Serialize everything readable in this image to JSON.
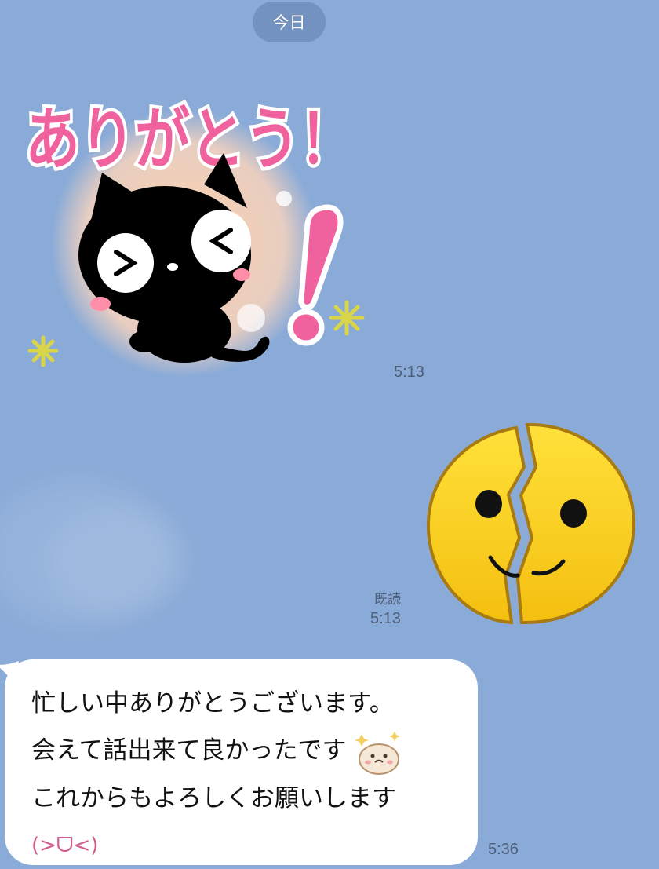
{
  "date_divider": "今日",
  "messages": [
    {
      "sticker_text": "ありがとう！",
      "sticker_description": "black-cat-thank-you-sticker",
      "time": "5:13"
    },
    {
      "sticker_description": "broken-smiley-face-sticker",
      "read_status": "既読",
      "time": "5:13"
    },
    {
      "text_lines": [
        "忙しい中ありがとうございます。",
        "会えて話出来て良かったです",
        "これからもよろしくお願いします"
      ],
      "emoji": "seal-emoji",
      "kaomoji": "(>ᗜ<)",
      "time": "5:36"
    }
  ],
  "colors": {
    "background": "#8aabd8",
    "bubble": "#ffffff",
    "pill": "#7392bf",
    "sticker_pink": "#f0629e",
    "smiley_yellow": "#f7d21c"
  }
}
